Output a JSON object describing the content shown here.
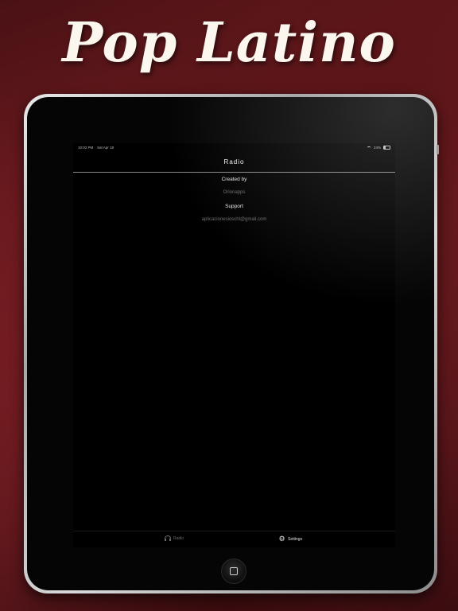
{
  "headline": "Pop Latino",
  "status_bar": {
    "time": "10:02 PM",
    "date": "Sat Apr 18",
    "battery": "24%"
  },
  "nav": {
    "title": "Radio"
  },
  "about": {
    "created_by_label": "Created by",
    "creator": "Orionapps",
    "support_label": "Support",
    "support_email": "aplicacionesioschl@gmail.com"
  },
  "tab_bar": {
    "items": [
      {
        "label": "Radio",
        "icon": "headphones-icon",
        "selected": false
      },
      {
        "label": "Settings",
        "icon": "gear-icon",
        "selected": true
      }
    ]
  },
  "colors": {
    "background": "#6e1a1f",
    "screen": "#000000",
    "active_tab": "#e0e0e0",
    "inactive_tab": "#6a6a6a"
  }
}
